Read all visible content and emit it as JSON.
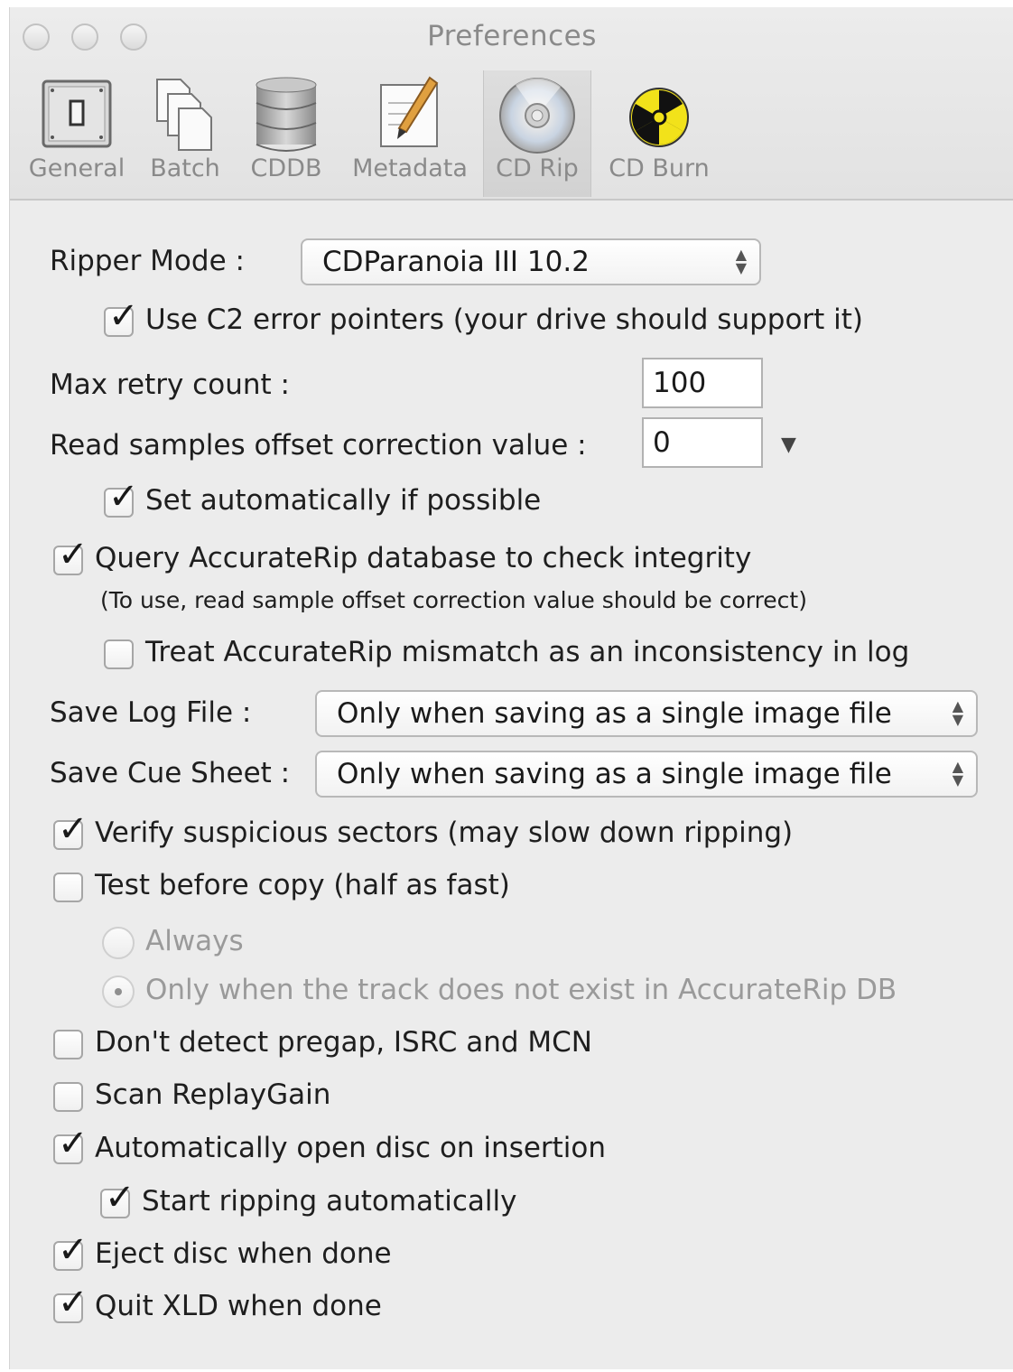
{
  "window": {
    "title": "Preferences"
  },
  "toolbar": {
    "tabs": [
      {
        "label": "General",
        "icon": "switch-icon"
      },
      {
        "label": "Batch",
        "icon": "documents-icon"
      },
      {
        "label": "CDDB",
        "icon": "database-icon"
      },
      {
        "label": "Metadata",
        "icon": "edit-pencil-icon"
      },
      {
        "label": "CD Rip",
        "icon": "cd-disc-icon",
        "selected": true
      },
      {
        "label": "CD Burn",
        "icon": "radiation-icon"
      }
    ]
  },
  "form": {
    "ripper_mode": {
      "label": "Ripper Mode :",
      "value": "CDParanoia III 10.2"
    },
    "use_c2": {
      "label": "Use C2 error pointers (your drive should support it)",
      "checked": true
    },
    "max_retry": {
      "label": "Max retry count :",
      "value": "100"
    },
    "offset": {
      "label": "Read samples offset correction value :",
      "value": "0"
    },
    "set_auto": {
      "label": "Set automatically if possible",
      "checked": true
    },
    "query_ar": {
      "label": "Query AccurateRip database to check integrity",
      "checked": true
    },
    "query_ar_note": "(To use, read sample offset correction value should be correct)",
    "treat_mismatch": {
      "label": "Treat AccurateRip mismatch as an inconsistency in log",
      "checked": false
    },
    "save_log": {
      "label": "Save Log File :",
      "value": "Only when saving as a single image file"
    },
    "save_cue": {
      "label": "Save Cue Sheet :",
      "value": "Only when saving as a single image file"
    },
    "verify": {
      "label": "Verify suspicious sectors (may slow down ripping)",
      "checked": true
    },
    "test_before": {
      "label": "Test before copy (half as fast)",
      "checked": false
    },
    "radio_always": {
      "label": "Always",
      "selected": false
    },
    "radio_only_when": {
      "label": "Only when the track does not exist in AccurateRip DB",
      "selected": true
    },
    "no_pregap": {
      "label": "Don't detect pregap, ISRC and MCN",
      "checked": false
    },
    "replaygain": {
      "label": "Scan ReplayGain",
      "checked": false
    },
    "auto_open": {
      "label": "Automatically open disc on insertion",
      "checked": true
    },
    "start_ripping": {
      "label": "Start ripping automatically",
      "checked": true
    },
    "eject": {
      "label": "Eject disc when done",
      "checked": true
    },
    "quit": {
      "label": "Quit XLD when done",
      "checked": true
    }
  }
}
